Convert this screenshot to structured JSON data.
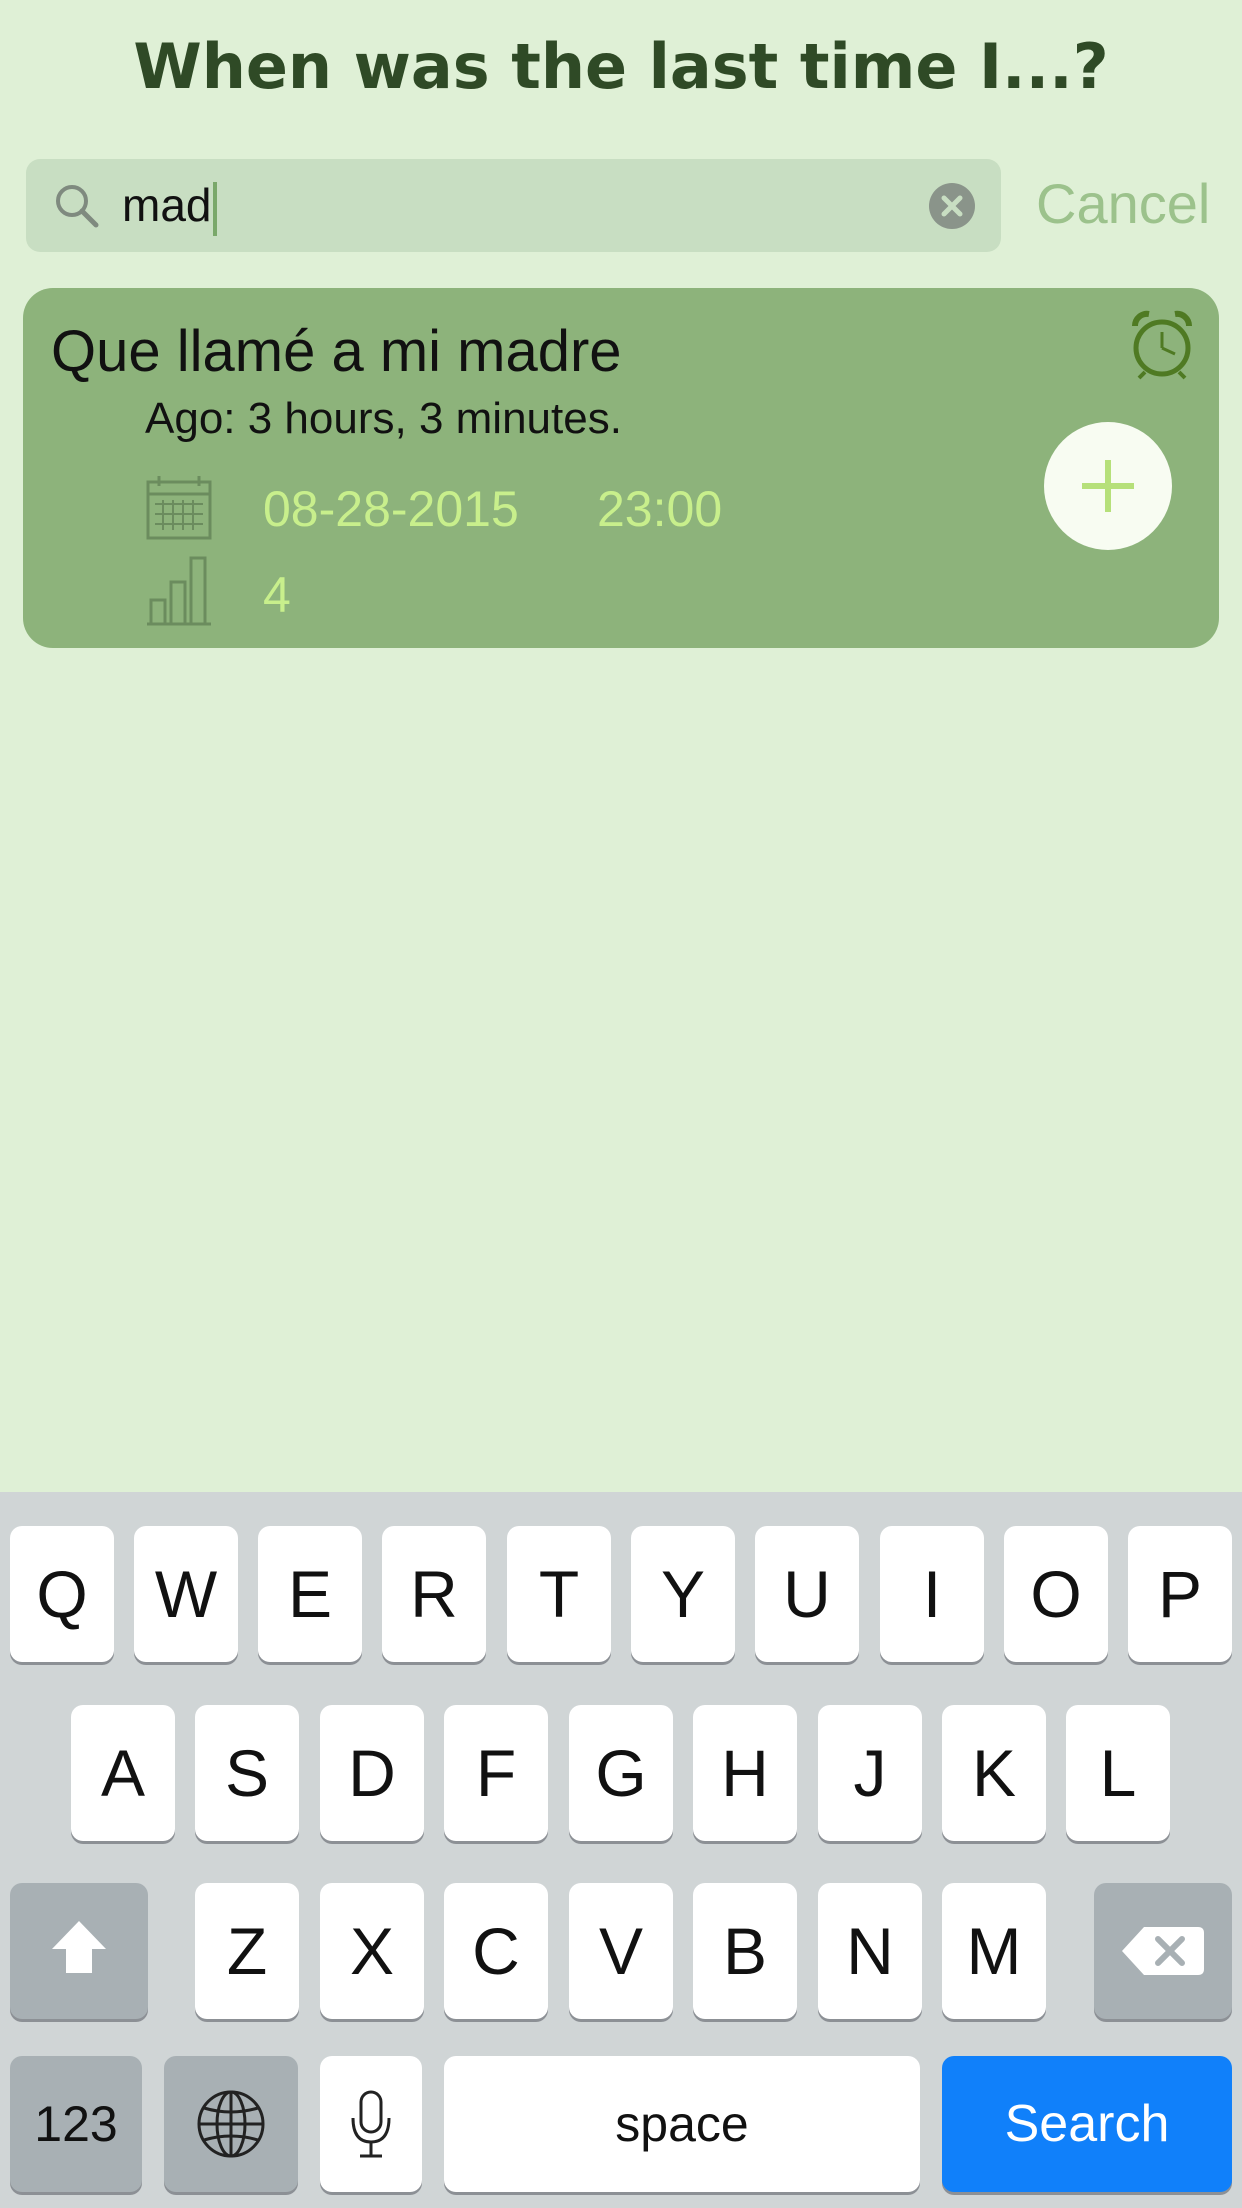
{
  "header": {
    "title": "When was the last time I...?"
  },
  "search": {
    "value": "mad",
    "cancel_label": "Cancel"
  },
  "results": [
    {
      "title": "Que llamé a mi madre",
      "ago": "Ago: 3 hours, 3 minutes.",
      "date": "08-28-2015",
      "time": "23:00",
      "count": "4"
    }
  ],
  "keyboard": {
    "row1": [
      "Q",
      "W",
      "E",
      "R",
      "T",
      "Y",
      "U",
      "I",
      "O",
      "P"
    ],
    "row2": [
      "A",
      "S",
      "D",
      "F",
      "G",
      "H",
      "J",
      "K",
      "L"
    ],
    "row3": [
      "Z",
      "X",
      "C",
      "V",
      "B",
      "N",
      "M"
    ],
    "numbers_label": "123",
    "space_label": "space",
    "search_label": "Search"
  },
  "colors": {
    "background": "#dff0d6",
    "card": "#8db37b",
    "accent_green": "#c8ef8c",
    "search_key": "#1080fa"
  },
  "icons": [
    "search-icon",
    "clear-icon",
    "calendar-icon",
    "stats-icon",
    "alarm-clock-icon",
    "plus-icon",
    "shift-icon",
    "globe-icon",
    "microphone-icon",
    "backspace-icon"
  ]
}
